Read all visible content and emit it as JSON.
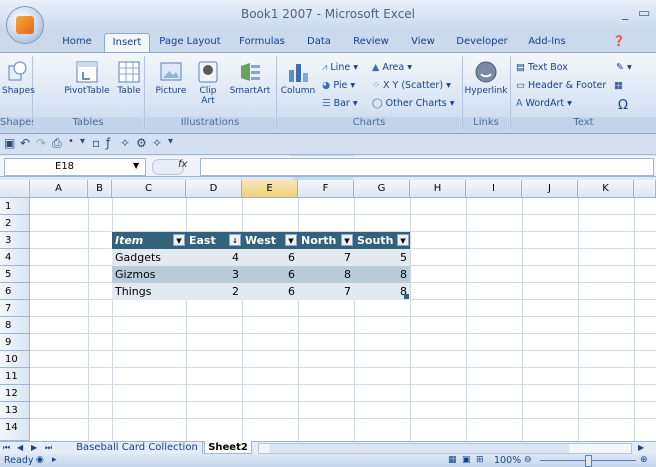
{
  "window": {
    "title": "Book1 2007 - Microsoft Excel",
    "minimize": "_",
    "restore": "▭"
  },
  "ribbon_tabs": [
    "Home",
    "Insert",
    "Page Layout",
    "Formulas",
    "Data",
    "Review",
    "View",
    "Developer",
    "Add-Ins"
  ],
  "active_tab": "Insert",
  "ribbon": {
    "shapes": {
      "label": "Shapes",
      "group": "Shapes"
    },
    "tables": {
      "pivottable": "PivotTable",
      "table": "Table",
      "group": "Tables"
    },
    "illustrations": {
      "picture": "Picture",
      "clipart_line1": "Clip",
      "clipart_line2": "Art",
      "smartart": "SmartArt",
      "group": "Illustrations"
    },
    "charts": {
      "column": "Column",
      "line": "Line",
      "pie": "Pie",
      "bar": "Bar",
      "area": "Area",
      "scatter": "X Y (Scatter)",
      "other": "Other Charts",
      "group": "Charts"
    },
    "links": {
      "hyperlink": "Hyperlink",
      "group": "Links"
    },
    "text": {
      "textbox": "Text Box",
      "header_footer": "Header & Footer",
      "wordart": "WordArt",
      "group": "Text"
    }
  },
  "formula_bar": {
    "name_box": "E18",
    "fx": "fx",
    "formula": ""
  },
  "columns": [
    "A",
    "B",
    "C",
    "D",
    "E",
    "F",
    "G",
    "H",
    "I",
    "J",
    "K"
  ],
  "rows": [
    "1",
    "2",
    "3",
    "4",
    "5",
    "6",
    "7",
    "8",
    "9",
    "10",
    "11",
    "12",
    "13",
    "14"
  ],
  "table": {
    "headers": [
      "Item",
      "East",
      "West",
      "North",
      "South"
    ],
    "rows": [
      [
        "Gadgets",
        "4",
        "6",
        "7",
        "5"
      ],
      [
        "Gizmos",
        "3",
        "6",
        "8",
        "8"
      ],
      [
        "Things",
        "2",
        "6",
        "7",
        "8"
      ]
    ]
  },
  "sheets": [
    "Baseball Card Collection",
    "Sheet2"
  ],
  "active_sheet": "Sheet2",
  "status": {
    "ready": "Ready",
    "zoom": "100%"
  },
  "colors": {
    "table_header": "#32627c",
    "band_dark": "#b9cdd9",
    "band_light": "#e2eaf0"
  }
}
